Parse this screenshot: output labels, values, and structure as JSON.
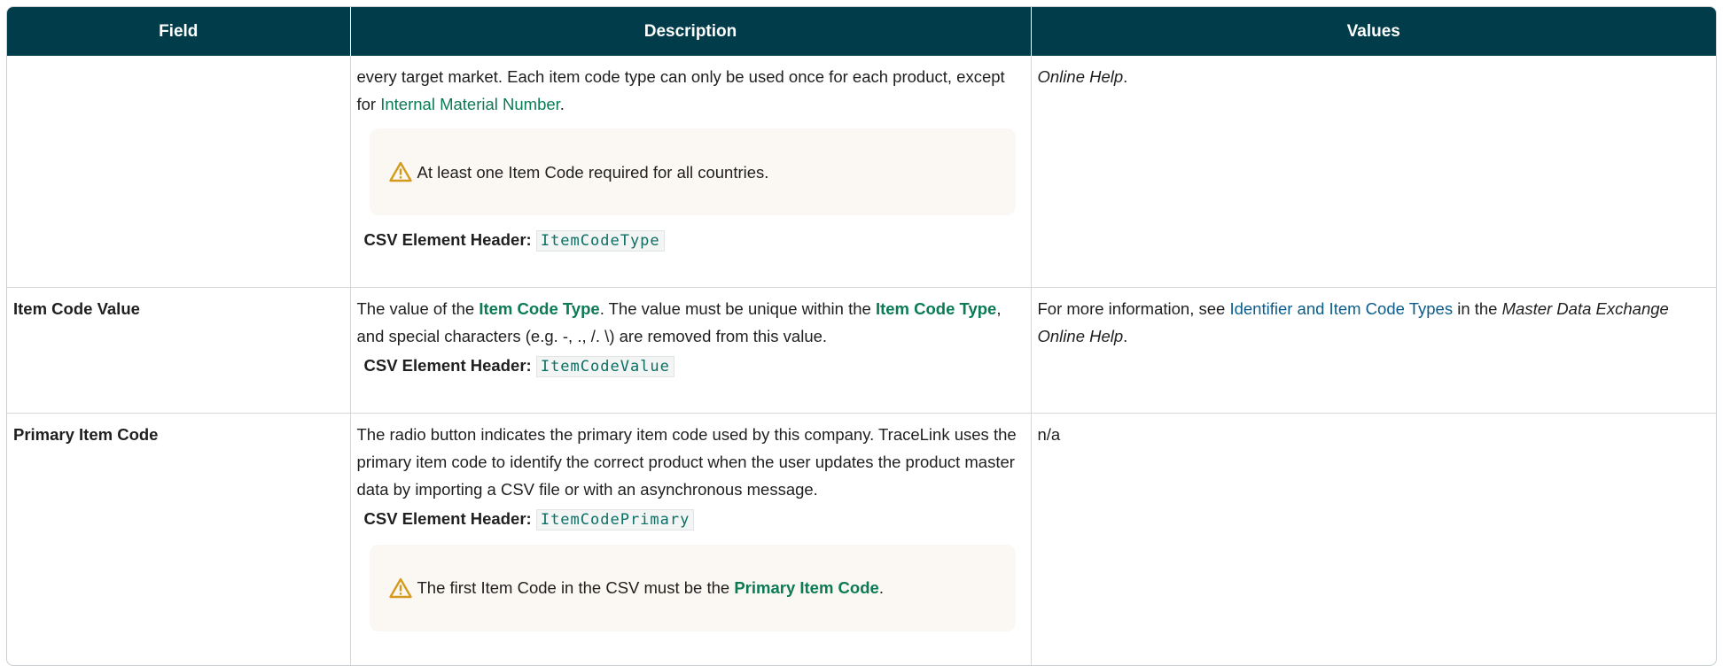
{
  "header": {
    "col_field": "Field",
    "col_description": "Description",
    "col_values": "Values"
  },
  "rows": [
    {
      "field": "",
      "description": {
        "text1": "every target market. Each item code type can only be used once for each product, except for ",
        "link": "Internal Material Number",
        "text2": ".",
        "note": "At least one Item Code required for all countries.",
        "csv_label": "CSV Element Header:",
        "csv_code": "ItemCodeType"
      },
      "values": {
        "italic": "Online Help",
        "suffix": "."
      }
    },
    {
      "field": "Item Code Value",
      "description": {
        "text1": "The value of the ",
        "link1": "Item Code Type",
        "text2": ". The value must be unique within the ",
        "link2": "Item Code Type",
        "text3": ", and special characters (e.g. -, ., /. \\) are removed from this value.",
        "csv_label": "CSV Element Header:",
        "csv_code": "ItemCodeValue"
      },
      "values": {
        "text1": "For more information, see ",
        "link": "Identifier and Item Code Types",
        "text2": " in the ",
        "italic": "Master Data Exchange Online Help",
        "suffix": "."
      }
    },
    {
      "field": "Primary Item Code",
      "description": {
        "text1": " The radio button indicates the primary item code used by this company. TraceLink uses the primary item code to identify the correct product when the user updates the product master data by importing a CSV file or with an asynchronous message.",
        "csv_label": "CSV Element Header:",
        "csv_code": "ItemCodePrimary",
        "note_text1": "The first Item Code in the CSV must be the ",
        "note_link": "Primary Item Code",
        "note_text2": "."
      },
      "values": {
        "text": "n/a"
      }
    }
  ],
  "icons": {
    "warning": "warning-triangle-icon"
  },
  "colors": {
    "header_bg": "#003c4a",
    "link_green": "#0b7a55",
    "link_blue": "#0a5d8c",
    "note_bg": "#fbf8f3",
    "warning_icon": "#d49a1c"
  }
}
